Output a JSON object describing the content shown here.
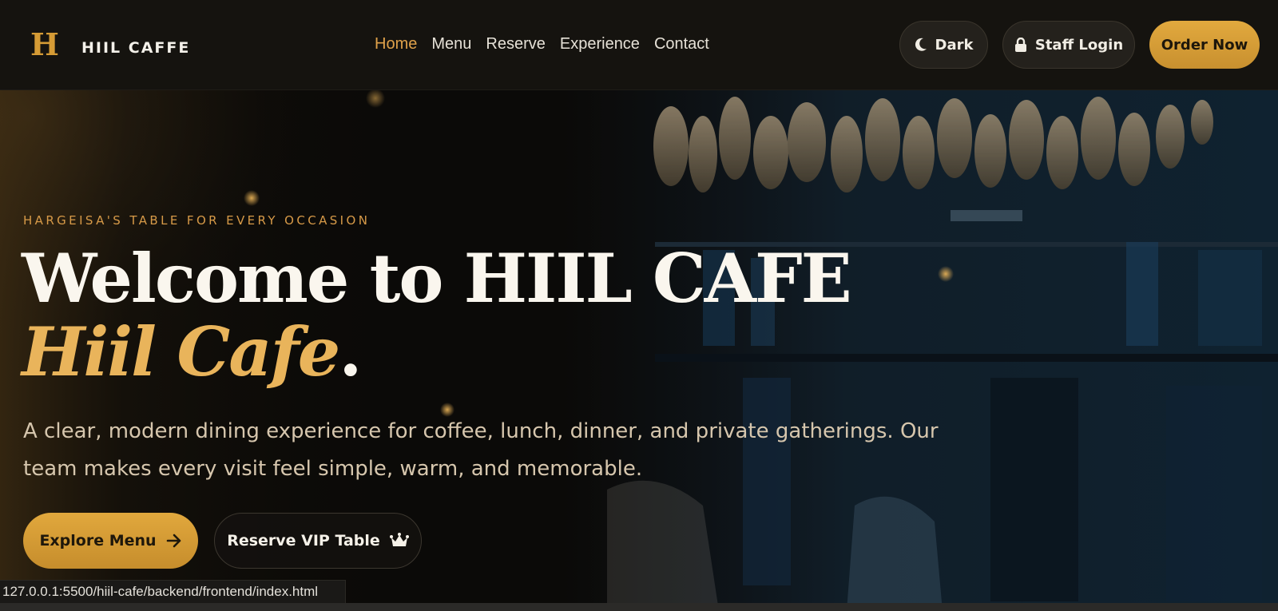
{
  "brand": {
    "mark": "H",
    "name": "HIIL CAFFE"
  },
  "nav": {
    "items": [
      {
        "label": "Home",
        "active": true
      },
      {
        "label": "Menu",
        "active": false
      },
      {
        "label": "Reserve",
        "active": false
      },
      {
        "label": "Experience",
        "active": false
      },
      {
        "label": "Contact",
        "active": false
      }
    ]
  },
  "header_actions": {
    "theme_label": "Dark",
    "theme_icon": "moon-icon",
    "staff_label": "Staff Login",
    "staff_icon": "lock-icon",
    "order_label": "Order Now"
  },
  "hero": {
    "eyebrow": "HARGEISA'S TABLE FOR EVERY OCCASION",
    "headline_line1": "Welcome to HIIL CAFE",
    "headline_accent": "Hiil Cafe",
    "headline_period": ".",
    "description": "A clear, modern dining experience for coffee, lunch, dinner, and private gatherings. Our team makes every visit feel simple, warm, and memorable.",
    "explore_label": "Explore Menu",
    "explore_icon": "arrow-right-icon",
    "reserve_label": "Reserve VIP Table",
    "reserve_icon": "crown-icon"
  },
  "status_url": "127.0.0.1:5500/hiil-cafe/backend/frontend/index.html",
  "colors": {
    "accent": "#dfa14a",
    "gold_button": "#d39a36",
    "header_bg": "#15130f",
    "text_light": "#f4f1ea"
  }
}
